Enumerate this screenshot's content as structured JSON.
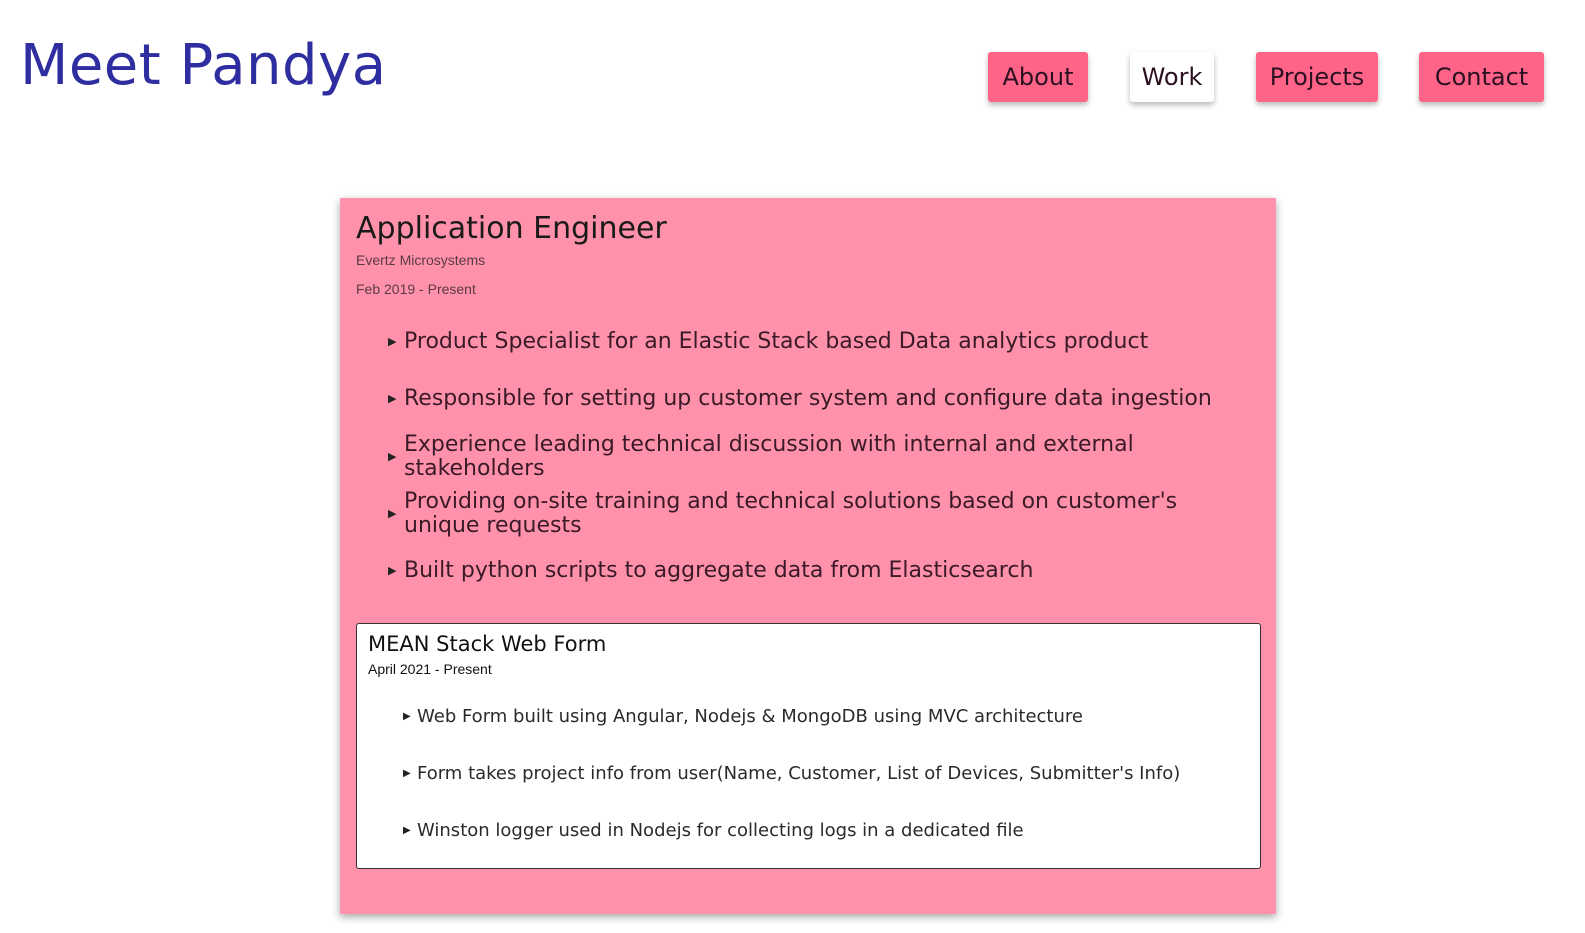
{
  "header": {
    "site_title": "Meet Pandya",
    "nav": [
      {
        "label": "About",
        "active": false
      },
      {
        "label": "Work",
        "active": true
      },
      {
        "label": "Projects",
        "active": false
      },
      {
        "label": "Contact",
        "active": false
      }
    ]
  },
  "job": {
    "title": "Application Engineer",
    "company": "Evertz Microsystems",
    "dates": "Feb 2019 - Present",
    "bullets": [
      "Product Specialist for an Elastic Stack based Data analytics product",
      "Responsible for setting up customer system and configure data ingestion",
      "Experience leading technical discussion with internal and external stakeholders",
      "Providing on-site training and technical solutions based on customer's unique requests",
      "Built python scripts to aggregate data from Elasticsearch"
    ]
  },
  "project": {
    "title": "MEAN Stack Web Form",
    "dates": "April 2021 - Present",
    "bullets": [
      "Web Form built using Angular, Nodejs & MongoDB using MVC architecture",
      "Form takes project info from user(Name, Customer, List of Devices, Submitter's Info)",
      "Winston logger used in Nodejs for collecting logs in a dedicated file"
    ]
  },
  "icons": {
    "bullet": "caret-right-icon"
  },
  "colors": {
    "title_color": "#2e2ea0",
    "nav_pink": "#ff6488",
    "card_background": "#ff92aa",
    "inner_card_background": "#ffffff"
  }
}
